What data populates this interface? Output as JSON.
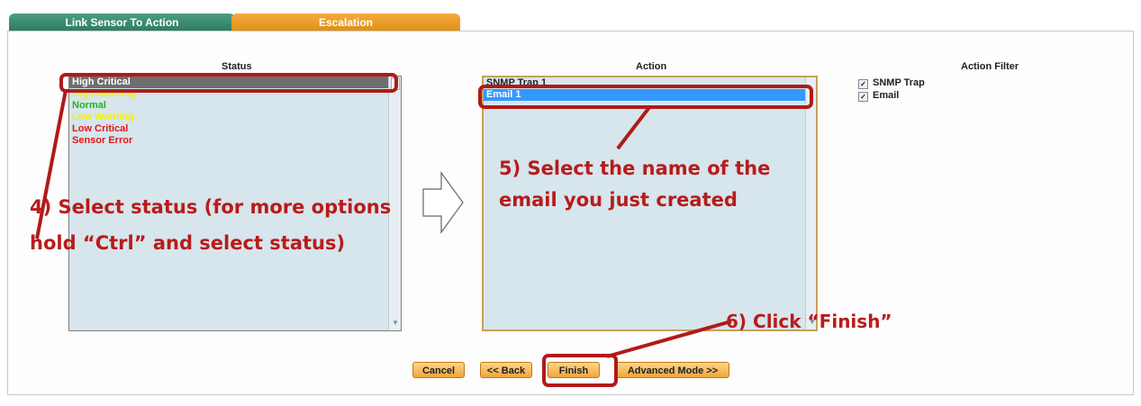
{
  "tabs": [
    "Link Sensor To Action",
    "Escalation"
  ],
  "status": {
    "heading": "Status",
    "items": [
      {
        "label": "High Critical",
        "color": "#ffffff",
        "selected": true
      },
      {
        "label": "High Warning",
        "color": "#f2f200"
      },
      {
        "label": "Normal",
        "color": "#22b322"
      },
      {
        "label": "Low Warning",
        "color": "#f2f200"
      },
      {
        "label": "Low Critical",
        "color": "#e01818"
      },
      {
        "label": "Sensor Error",
        "color": "#e01818"
      }
    ]
  },
  "action": {
    "heading": "Action",
    "items": [
      {
        "label": "SNMP Trap 1"
      },
      {
        "label": "Email 1",
        "selected": true
      }
    ]
  },
  "action_filter": {
    "heading": "Action Filter",
    "items": [
      {
        "label": "SNMP Trap",
        "checked": true
      },
      {
        "label": "Email",
        "checked": true
      }
    ]
  },
  "buttons": {
    "cancel": "Cancel",
    "back": "<< Back",
    "finish": "Finish",
    "advanced": "Advanced Mode >>"
  },
  "annotations": {
    "step4_line1": "4) Select status (for more options",
    "step4_line2": "hold “Ctrl” and select status)",
    "step5_line1": "5) Select the name of the",
    "step5_line2": "email you just created",
    "step6": "6) Click “Finish”"
  },
  "colors": {
    "annotation": "#b81b1b",
    "selected_status_bg": "#6e6e6e",
    "selected_action_bg": "#3399ff"
  }
}
